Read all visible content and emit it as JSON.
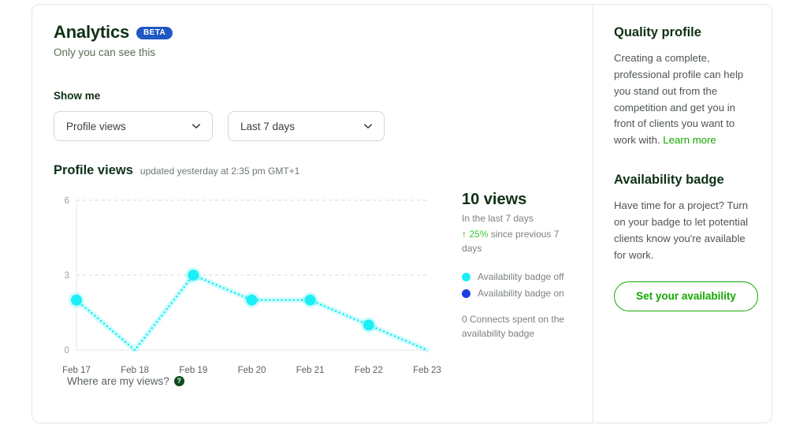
{
  "header": {
    "title": "Analytics",
    "badge": "BETA",
    "subtitle": "Only you can see this"
  },
  "filters": {
    "label": "Show me",
    "metric_select": {
      "value": "Profile views",
      "icon": "chevron-down-icon"
    },
    "range_select": {
      "value": "Last 7 days",
      "icon": "chevron-down-icon"
    }
  },
  "chart_header": {
    "title": "Profile views",
    "updated": "updated yesterday at 2:35 pm GMT+1"
  },
  "stats": {
    "total": "10 views",
    "period": "In the last 7 days",
    "arrow": "↑",
    "delta_pct": "25%",
    "delta_rest": " since previous 7 days",
    "legend": [
      {
        "label": "Availability badge off",
        "color": "#1beff5"
      },
      {
        "label": "Availability badge on",
        "color": "#1f3fe0"
      }
    ],
    "connects_note": "0 Connects spent on the availability badge"
  },
  "footer": {
    "where_label": "Where are my views?",
    "help_icon": "help-circle-icon",
    "help_glyph": "?"
  },
  "sidebar": {
    "quality_heading": "Quality profile",
    "quality_body": "Creating a complete, professional profile can help you stand out from the competition and get you in front of clients you want to work with. ",
    "learn_more": "Learn more",
    "availability_heading": "Availability badge",
    "availability_body": "Have time for a project? Turn on your badge to let potential clients know you're available for work.",
    "availability_button": "Set your availability"
  },
  "chart_data": {
    "type": "line",
    "title": "Profile views",
    "categories": [
      "Feb 17",
      "Feb 18",
      "Feb 19",
      "Feb 20",
      "Feb 21",
      "Feb 22",
      "Feb 23"
    ],
    "series": [
      {
        "name": "Availability badge off",
        "color": "#1beff5",
        "values": [
          2,
          0,
          3,
          2,
          2,
          1,
          0
        ],
        "markers": [
          true,
          false,
          true,
          true,
          true,
          true,
          false
        ]
      }
    ],
    "ylim": [
      0,
      6
    ],
    "yticks": [
      0,
      3,
      6
    ],
    "ytick_labels": [
      "0",
      "3",
      "6"
    ],
    "xlabel": "",
    "ylabel": "",
    "grid": true,
    "line_style": "dotted",
    "legend_position": "right"
  }
}
